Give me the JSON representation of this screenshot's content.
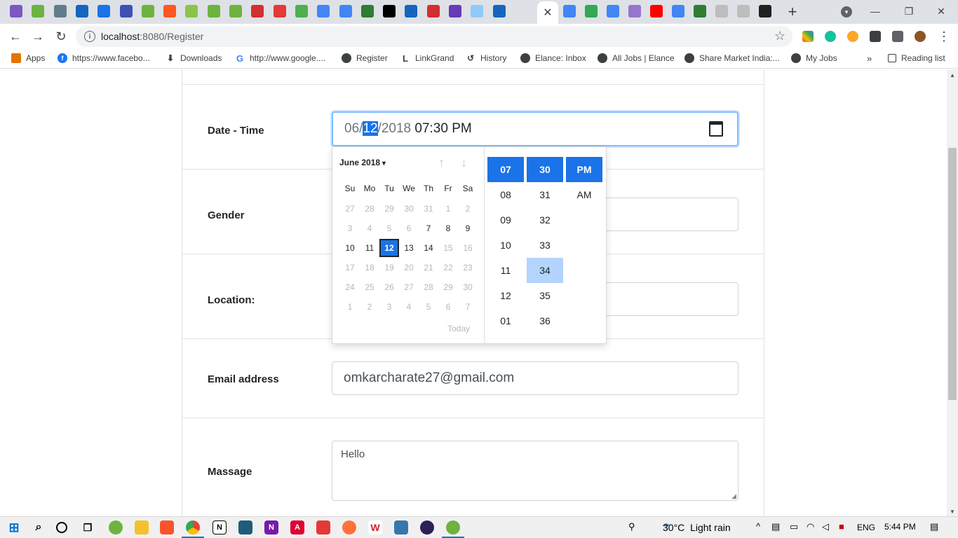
{
  "browser": {
    "active_tab_close": "✕",
    "new_tab": "+",
    "url_host": "localhost",
    "url_rest": ":8080/Register",
    "bookmarks": [
      {
        "label": "Apps",
        "icon": "apps-grid-icon"
      },
      {
        "label": "https://www.facebo...",
        "icon": "facebook-icon"
      },
      {
        "label": "Downloads",
        "icon": "download-icon"
      },
      {
        "label": "http://www.google....",
        "icon": "google-icon"
      },
      {
        "label": "Register",
        "icon": "globe-icon"
      },
      {
        "label": "LinkGrand",
        "icon": "linkgrand-icon"
      },
      {
        "label": "History",
        "icon": "history-icon"
      },
      {
        "label": "Elance: Inbox",
        "icon": "globe-icon"
      },
      {
        "label": "All Jobs | Elance",
        "icon": "globe-icon"
      },
      {
        "label": "Share Market India:...",
        "icon": "globe-icon"
      },
      {
        "label": "My Jobs",
        "icon": "globe-icon"
      }
    ],
    "more_bookmarks": "»",
    "reading_list": "Reading list"
  },
  "form": {
    "datetime_label": "Date - Time",
    "datetime_month": "06/",
    "datetime_day": "12",
    "datetime_year": "/2018",
    "datetime_time": "07:30",
    "datetime_ampm": "PM",
    "gender_label": "Gender",
    "location_label": "Location:",
    "email_label": "Email address",
    "email_value": "omkarcharate27@gmail.com",
    "message_label": "Massage",
    "message_value": "Hello"
  },
  "picker": {
    "month_year": "June 2018",
    "weekdays": [
      "Su",
      "Mo",
      "Tu",
      "We",
      "Th",
      "Fr",
      "Sa"
    ],
    "weeks": [
      [
        {
          "d": "27",
          "s": "muted"
        },
        {
          "d": "28",
          "s": "muted"
        },
        {
          "d": "29",
          "s": "muted"
        },
        {
          "d": "30",
          "s": "muted"
        },
        {
          "d": "31",
          "s": "muted"
        },
        {
          "d": "1",
          "s": "muted"
        },
        {
          "d": "2",
          "s": "muted"
        }
      ],
      [
        {
          "d": "3",
          "s": "muted"
        },
        {
          "d": "4",
          "s": "muted"
        },
        {
          "d": "5",
          "s": "muted"
        },
        {
          "d": "6",
          "s": "muted"
        },
        {
          "d": "7",
          "s": "active"
        },
        {
          "d": "8",
          "s": "active"
        },
        {
          "d": "9",
          "s": "active"
        }
      ],
      [
        {
          "d": "10",
          "s": "active"
        },
        {
          "d": "11",
          "s": "active"
        },
        {
          "d": "12",
          "s": "selected"
        },
        {
          "d": "13",
          "s": "active"
        },
        {
          "d": "14",
          "s": "active"
        },
        {
          "d": "15",
          "s": "muted"
        },
        {
          "d": "16",
          "s": "muted"
        }
      ],
      [
        {
          "d": "17",
          "s": "muted"
        },
        {
          "d": "18",
          "s": "muted"
        },
        {
          "d": "19",
          "s": "muted"
        },
        {
          "d": "20",
          "s": "muted"
        },
        {
          "d": "21",
          "s": "muted"
        },
        {
          "d": "22",
          "s": "muted"
        },
        {
          "d": "23",
          "s": "muted"
        }
      ],
      [
        {
          "d": "24",
          "s": "muted"
        },
        {
          "d": "25",
          "s": "muted"
        },
        {
          "d": "26",
          "s": "muted"
        },
        {
          "d": "27",
          "s": "muted"
        },
        {
          "d": "28",
          "s": "muted"
        },
        {
          "d": "29",
          "s": "muted"
        },
        {
          "d": "30",
          "s": "muted"
        }
      ],
      [
        {
          "d": "1",
          "s": "muted"
        },
        {
          "d": "2",
          "s": "muted"
        },
        {
          "d": "3",
          "s": "muted"
        },
        {
          "d": "4",
          "s": "muted"
        },
        {
          "d": "5",
          "s": "muted"
        },
        {
          "d": "6",
          "s": "muted"
        },
        {
          "d": "7",
          "s": "muted"
        }
      ]
    ],
    "today_label": "Today",
    "hours": [
      "07",
      "08",
      "09",
      "10",
      "11",
      "12",
      "01"
    ],
    "minutes": [
      "30",
      "31",
      "32",
      "33",
      "34",
      "35",
      "36"
    ],
    "periods": [
      "PM",
      "AM"
    ],
    "selected_hour": "07",
    "selected_minute": "30",
    "selected_period": "PM",
    "hovered_minute": "34",
    "accent_color": "#1a73e8"
  },
  "taskbar": {
    "temperature": "30°C",
    "weather": "Light rain",
    "language": "ENG",
    "time": "5:44 PM"
  }
}
